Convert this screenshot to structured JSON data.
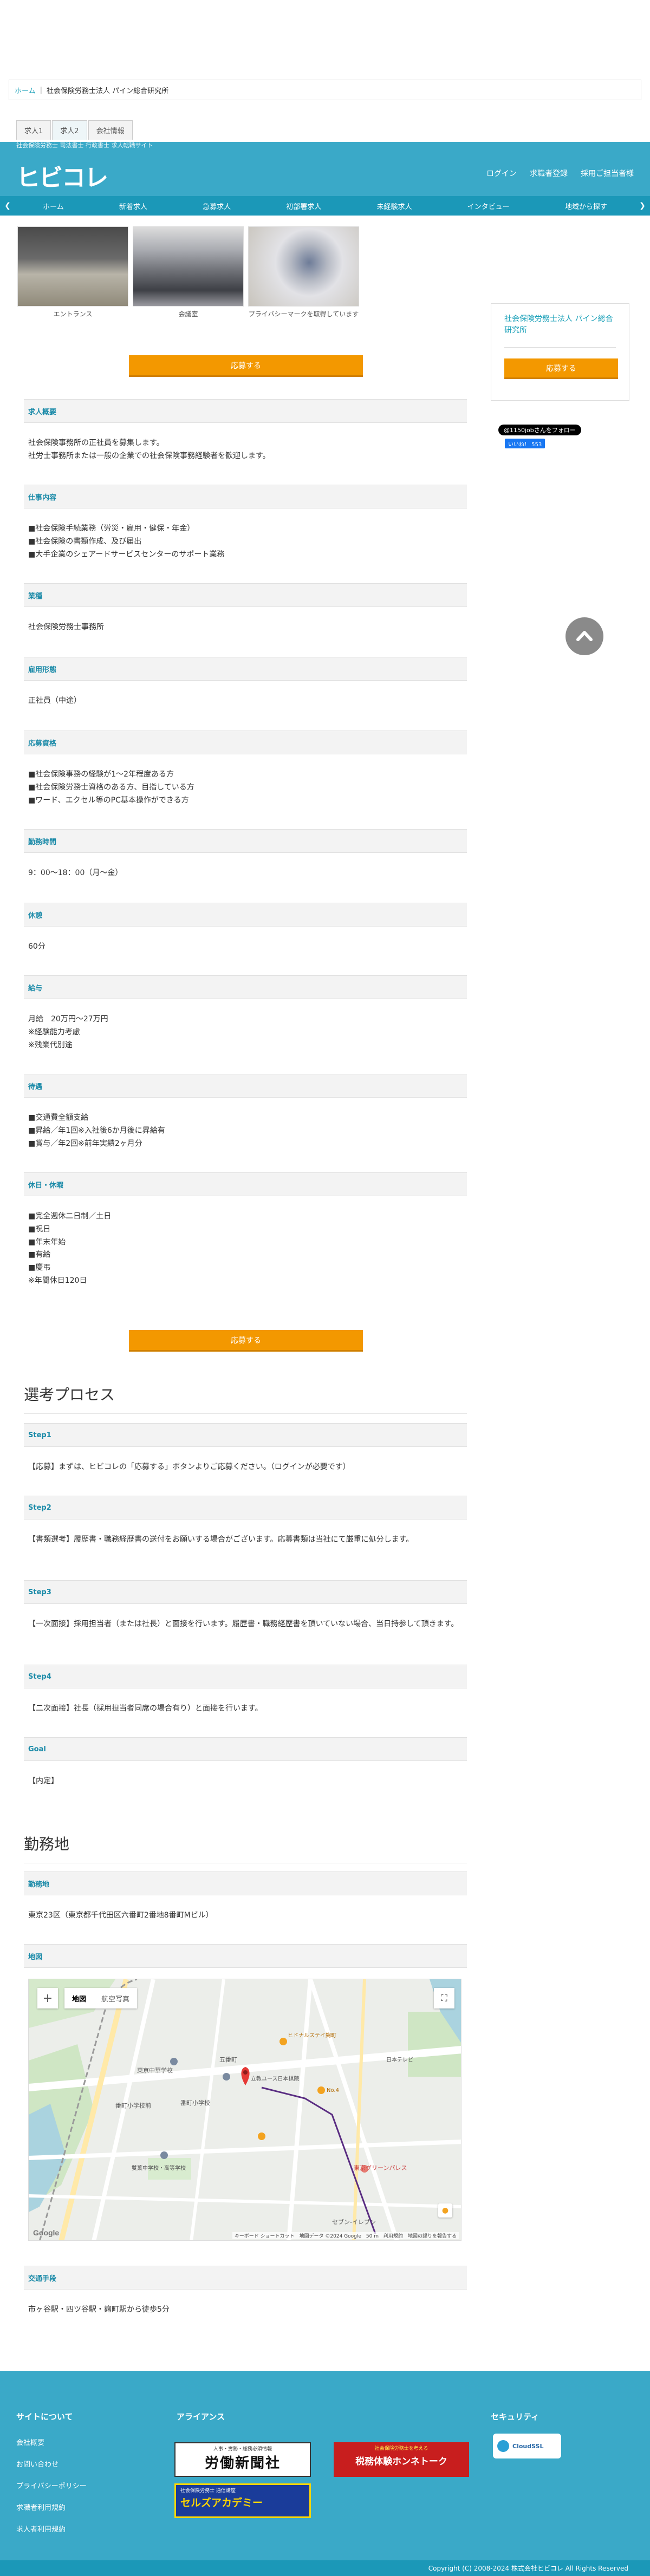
{
  "breadcrumb": {
    "home": "ホーム",
    "current": "社会保険労務士法人 パイン総合研究所"
  },
  "tabs": [
    "求人1",
    "求人2",
    "会社情報"
  ],
  "header": {
    "tagline": "社会保険労務士 司法書士 行政書士 求人転職サイト",
    "logo": "ヒビコレ",
    "nav": [
      "ログイン",
      "求職者登録",
      "採用ご担当者様"
    ]
  },
  "mainnav": {
    "items": [
      "ホーム",
      "新着求人",
      "急募求人",
      "初部署求人",
      "未経験求人",
      "インタビュー",
      "地域から探す"
    ]
  },
  "gallery": [
    {
      "caption": "エントランス"
    },
    {
      "caption": "会議室"
    },
    {
      "caption": "プライバシーマークを取得しています"
    }
  ],
  "apply_label": "応募する",
  "sidebar": {
    "company": "社会保険労務士法人 パイン総合研究所",
    "apply_label": "応募する",
    "x_follow": "@1150jobさんをフォロー",
    "fb_like": "いいね！ 553"
  },
  "sections": [
    {
      "title": "求人概要",
      "body": [
        "社会保険事務所の正社員を募集します。",
        "社労士事務所または一般の企業での社会保険事務経験者を歓迎します。"
      ]
    },
    {
      "title": "仕事内容",
      "body": [
        "■社会保険手続業務（労災・雇用・健保・年金）",
        "■社会保険の書類作成、及び届出",
        "■大手企業のシェアードサービスセンターのサポート業務"
      ]
    },
    {
      "title": "業種",
      "body": [
        "社会保険労務士事務所"
      ]
    },
    {
      "title": "雇用形態",
      "body": [
        "正社員（中途）"
      ]
    },
    {
      "title": "応募資格",
      "body": [
        "■社会保険事務の経験が1～2年程度ある方",
        "■社会保険労務士資格のある方、目指している方",
        "■ワード、エクセル等のPC基本操作ができる方"
      ]
    },
    {
      "title": "勤務時間",
      "body": [
        "9：00〜18：00（月〜金）"
      ]
    },
    {
      "title": "休憩",
      "body": [
        "60分"
      ]
    },
    {
      "title": "給与",
      "body": [
        "月給　20万円〜27万円",
        "※経験能力考慮",
        "※残業代別途"
      ]
    },
    {
      "title": "待遇",
      "body": [
        "■交通費全額支給",
        "■昇給／年1回※入社後6か月後に昇給有",
        "■賞与／年2回※前年実績2ヶ月分"
      ]
    },
    {
      "title": "休日・休暇",
      "body": [
        "■完全週休二日制／土日",
        "■祝日",
        "■年末年始",
        "■有給",
        "■慶弔",
        "※年間休日120日"
      ]
    }
  ],
  "process": {
    "title": "選考プロセス",
    "steps": [
      {
        "title": "Step1",
        "body": "【応募】まずは、ヒビコレの「応募する」ボタンよりご応募ください。（ログインが必要です）"
      },
      {
        "title": "Step2",
        "body": "【書類選考】履歴書・職務経歴書の送付をお願いする場合がございます。応募書類は当社にて厳重に処分します。"
      },
      {
        "title": "Step3",
        "body": "【一次面接】採用担当者（または社長）と面接を行います。履歴書・職務経歴書を頂いていない場合、当日持参して頂きます。"
      },
      {
        "title": "Step4",
        "body": "【二次面接】社長（採用担当者同席の場合有り）と面接を行います。"
      },
      {
        "title": "Goal",
        "body": "【内定】"
      }
    ]
  },
  "location": {
    "title": "勤務地",
    "address_title": "勤務地",
    "address": "東京23区（東京都千代田区六番町2番地8番町Mビル）",
    "map_title": "地図",
    "map_buttons": [
      "地図",
      "航空写真"
    ],
    "map_labels": [
      "五番町",
      "東京中華学校",
      "ヒドナルステイ麹町",
      "日本テレビ",
      "立教ユース日本棋院",
      "番町小学校前",
      "番町小学校",
      "東京グリーンパレス",
      "雙葉中学校・高等学校",
      "セブン-イレブン",
      "No.4"
    ],
    "map_attribution": "キーボード ショートカット　地図データ ©2024 Google　50 m　利用規約　地図の誤りを報告する",
    "access_title": "交通手段",
    "access": "市ヶ谷駅・四ツ谷駅・麹町駅から徒歩5分"
  },
  "footer": {
    "col1_title": "サイトについて",
    "col1_links": [
      "会社概要",
      "お問い合わせ",
      "プライバシーポリシー",
      "求職者利用規約",
      "求人者利用規約"
    ],
    "col2_title": "アライアンス",
    "banner1": "労働新聞社",
    "banner1_sub": "人事・労務・総務必須情報",
    "banner2": "税務体験ホンネトーク",
    "banner2_sub": "社会保険労務士を考える",
    "banner3": "セルズアカデミー",
    "banner3_sub": "社会保険労務士 通信講座",
    "col3_title": "セキュリティ",
    "ssl": "CloudSSL",
    "copyright": "Copyright (C) 2008-2024 株式会社ヒビコレ All Rights Reserved"
  }
}
